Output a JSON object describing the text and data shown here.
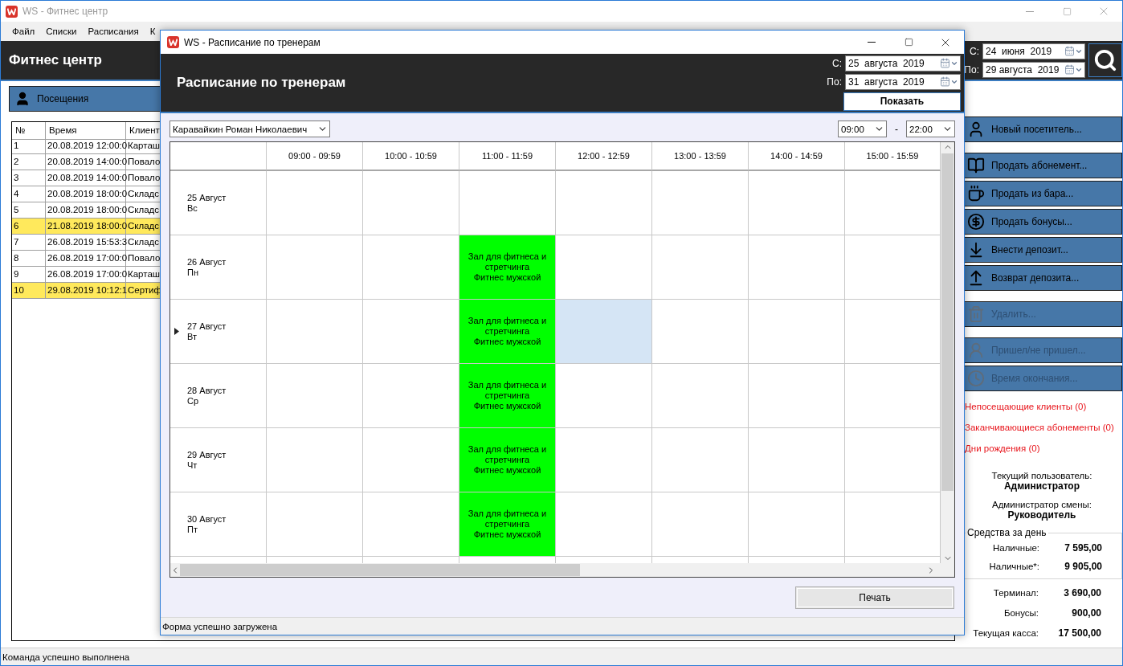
{
  "main_window": {
    "title": "WS - Фитнес центр",
    "menu": [
      "Файл",
      "Списки",
      "Расписания",
      "К"
    ],
    "header": {
      "title": "Фитнес центр",
      "from_label": "С:",
      "from_date": "24  июня  2019",
      "to_label": "По:",
      "to_date": "29 августа  2019"
    },
    "visits_button": "Посещения",
    "visits_table": {
      "columns": [
        "№",
        "Время",
        "Клиент"
      ],
      "rows": [
        {
          "cells": [
            "1",
            "20.08.2019 12:00:0",
            "Карташ"
          ],
          "highlighted": false
        },
        {
          "cells": [
            "2",
            "20.08.2019 14:00:0",
            "Повало"
          ],
          "highlighted": false
        },
        {
          "cells": [
            "3",
            "20.08.2019 14:00:0",
            "Повало"
          ],
          "highlighted": false
        },
        {
          "cells": [
            "4",
            "20.08.2019 18:00:0",
            "Складс"
          ],
          "highlighted": false
        },
        {
          "cells": [
            "5",
            "20.08.2019 18:00:0",
            "Складс"
          ],
          "highlighted": false
        },
        {
          "cells": [
            "6",
            "21.08.2019 18:00:0",
            "Складс"
          ],
          "highlighted": true
        },
        {
          "cells": [
            "7",
            "26.08.2019 15:53:3",
            "Складс"
          ],
          "highlighted": false
        },
        {
          "cells": [
            "8",
            "26.08.2019 17:00:0",
            "Повало"
          ],
          "highlighted": false
        },
        {
          "cells": [
            "9",
            "26.08.2019 17:00:0",
            "Карташ"
          ],
          "highlighted": false
        },
        {
          "cells": [
            "10",
            "29.08.2019 10:12:1",
            "Сертиф"
          ],
          "highlighted": true
        }
      ]
    },
    "action_groups": [
      [
        {
          "label": "Новый посетитель...",
          "disabled": false
        }
      ],
      [
        {
          "label": "Продать абонемент...",
          "disabled": false
        },
        {
          "label": "Продать из бара...",
          "disabled": false
        },
        {
          "label": "Продать бонусы...",
          "disabled": false
        },
        {
          "label": "Внести депозит...",
          "disabled": false
        },
        {
          "label": "Возврат депозита...",
          "disabled": false
        }
      ],
      [
        {
          "label": "Удалить...",
          "disabled": true
        }
      ],
      [
        {
          "label": "Пришел/не пришел...",
          "disabled": true
        },
        {
          "label": "Время окончания...",
          "disabled": true
        }
      ]
    ],
    "alerts": [
      "Непосещающие клиенты (0)",
      "Заканчивающиеся абонементы (0)",
      "Дни рождения (0)"
    ],
    "current_user_label": "Текущий пользователь:",
    "current_user": "Администратор",
    "shift_admin_label": "Администратор смены:",
    "shift_admin": "Руководитель",
    "funds": {
      "title": "Средства за день",
      "rows": [
        {
          "label": "Наличные:",
          "value": "7 595,00"
        },
        {
          "label": "Наличные*:",
          "value": "9 905,00"
        }
      ]
    },
    "totals": [
      {
        "label": "Терминал:",
        "value": "3 690,00"
      },
      {
        "label": "Бонусы:",
        "value": "900,00"
      },
      {
        "label": "Текущая касса:",
        "value": "17 500,00"
      }
    ],
    "status": "Команда успешно выполнена"
  },
  "dialog": {
    "title": "WS - Расписание по тренерам",
    "header": {
      "title": "Расписание по тренерам",
      "from_label": "С:",
      "from_date": "25  августа  2019",
      "to_label": "По:",
      "to_date": "31  августа  2019",
      "show_button": "Показать"
    },
    "trainer": "Каравайкин Роман Николаевич",
    "time_from": "09:00",
    "time_separator": "-",
    "time_to": "22:00",
    "schedule": {
      "columns": [
        "09:00 - 09:59",
        "10:00 - 10:59",
        "11:00 - 11:59",
        "12:00 - 12:59",
        "13:00 - 13:59",
        "14:00 - 14:59",
        "15:00 - 15:59"
      ],
      "days": [
        {
          "date": "25 Август",
          "weekday": "Вс",
          "current": false,
          "cells": [
            {
              "kind": "empty",
              "selected": false
            },
            {
              "kind": "empty",
              "selected": false
            },
            {
              "kind": "empty",
              "selected": false
            },
            {
              "kind": "empty",
              "selected": false
            },
            {
              "kind": "empty",
              "selected": false
            },
            {
              "kind": "empty",
              "selected": false
            },
            {
              "kind": "empty",
              "selected": false
            }
          ]
        },
        {
          "date": "26 Август",
          "weekday": "Пн",
          "current": false,
          "cells": [
            {
              "kind": "empty",
              "selected": false
            },
            {
              "kind": "empty",
              "selected": false
            },
            {
              "kind": "booked",
              "selected": false,
              "room": "Зал для фитнеса и стретчинга",
              "activity": "Фитнес мужской"
            },
            {
              "kind": "empty",
              "selected": false
            },
            {
              "kind": "empty",
              "selected": false
            },
            {
              "kind": "empty",
              "selected": false
            },
            {
              "kind": "empty",
              "selected": false
            }
          ]
        },
        {
          "date": "27 Август",
          "weekday": "Вт",
          "current": true,
          "cells": [
            {
              "kind": "empty",
              "selected": false
            },
            {
              "kind": "empty",
              "selected": false
            },
            {
              "kind": "booked",
              "selected": false,
              "room": "Зал для фитнеса и стретчинга",
              "activity": "Фитнес мужской"
            },
            {
              "kind": "empty",
              "selected": true
            },
            {
              "kind": "empty",
              "selected": false
            },
            {
              "kind": "empty",
              "selected": false
            },
            {
              "kind": "empty",
              "selected": false
            }
          ]
        },
        {
          "date": "28 Август",
          "weekday": "Ср",
          "current": false,
          "cells": [
            {
              "kind": "empty",
              "selected": false
            },
            {
              "kind": "empty",
              "selected": false
            },
            {
              "kind": "booked",
              "selected": false,
              "room": "Зал для фитнеса и стретчинга",
              "activity": "Фитнес мужской"
            },
            {
              "kind": "empty",
              "selected": false
            },
            {
              "kind": "empty",
              "selected": false
            },
            {
              "kind": "empty",
              "selected": false
            },
            {
              "kind": "empty",
              "selected": false
            }
          ]
        },
        {
          "date": "29 Август",
          "weekday": "Чт",
          "current": false,
          "cells": [
            {
              "kind": "empty",
              "selected": false
            },
            {
              "kind": "empty",
              "selected": false
            },
            {
              "kind": "booked",
              "selected": false,
              "room": "Зал для фитнеса и стретчинга",
              "activity": "Фитнес мужской"
            },
            {
              "kind": "empty",
              "selected": false
            },
            {
              "kind": "empty",
              "selected": false
            },
            {
              "kind": "empty",
              "selected": false
            },
            {
              "kind": "empty",
              "selected": false
            }
          ]
        },
        {
          "date": "30 Август",
          "weekday": "Пт",
          "current": false,
          "cells": [
            {
              "kind": "empty",
              "selected": false
            },
            {
              "kind": "empty",
              "selected": false
            },
            {
              "kind": "booked",
              "selected": false,
              "room": "Зал для фитнеса и стретчинга",
              "activity": "Фитнес мужской"
            },
            {
              "kind": "empty",
              "selected": false
            },
            {
              "kind": "empty",
              "selected": false
            },
            {
              "kind": "empty",
              "selected": false
            },
            {
              "kind": "empty",
              "selected": false
            }
          ]
        }
      ]
    },
    "print_button": "Печать",
    "status": "Форма успешно загружена"
  }
}
